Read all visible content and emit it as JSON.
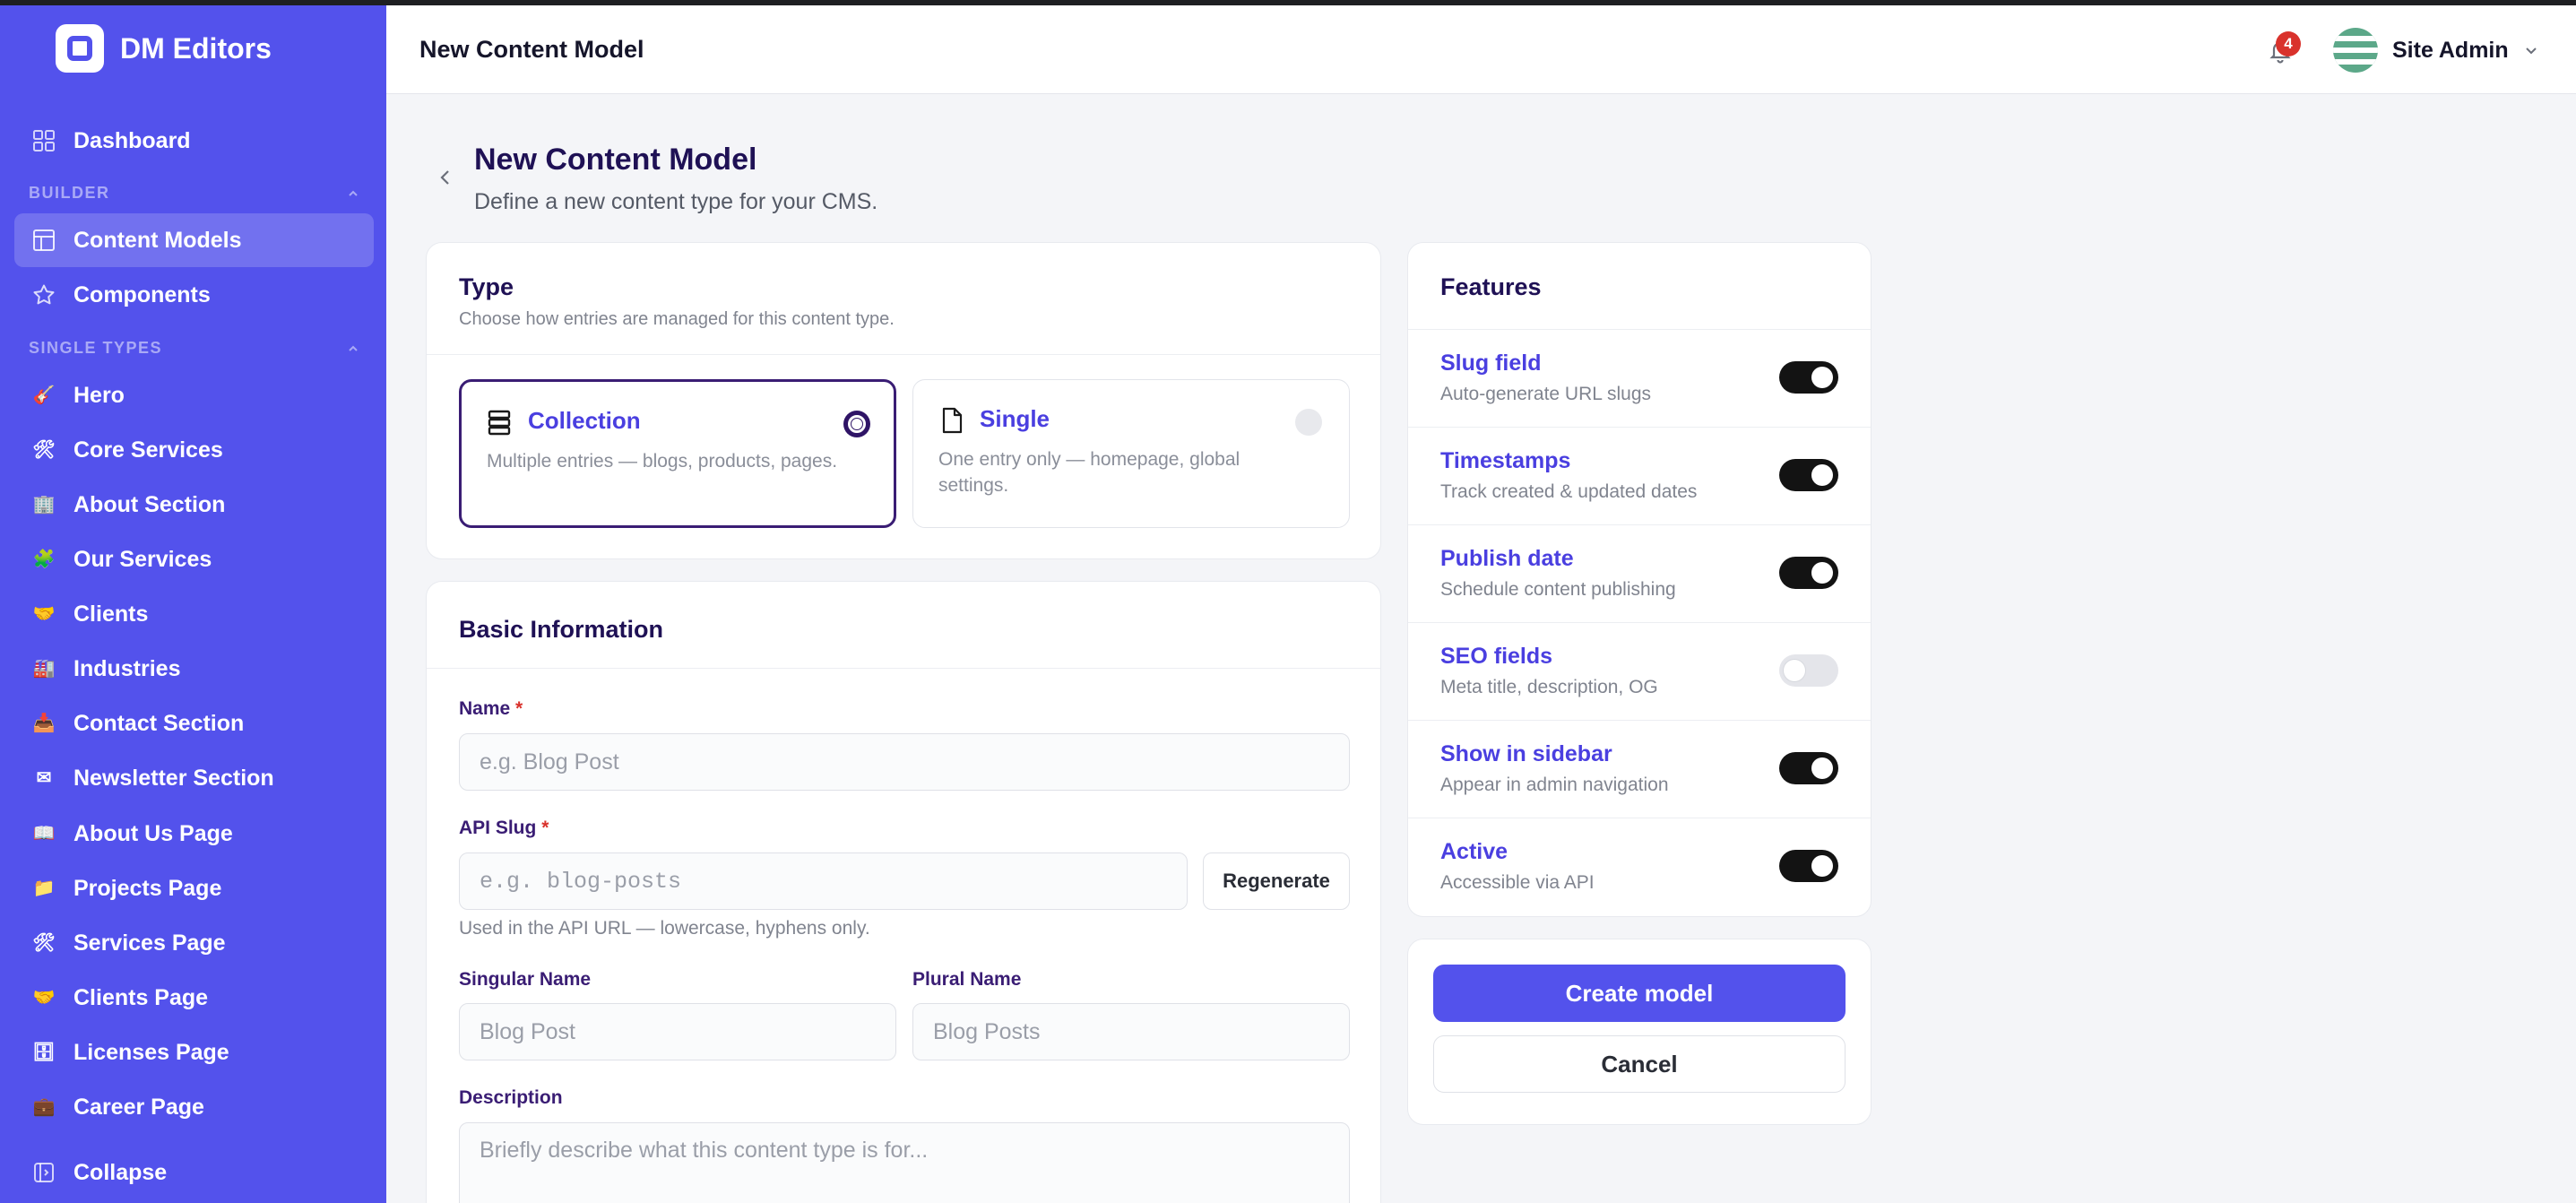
{
  "brand": {
    "name": "DM Editors"
  },
  "sidebar": {
    "dashboard": "Dashboard",
    "builder_label": "BUILDER",
    "builder_items": [
      {
        "label": "Content Models",
        "icon": "layout-icon"
      },
      {
        "label": "Components",
        "icon": "star-icon"
      }
    ],
    "single_types_label": "SINGLE TYPES",
    "single_items": [
      {
        "label": "Hero",
        "icon": "guitar-emoji"
      },
      {
        "label": "Core Services",
        "icon": "tools-emoji"
      },
      {
        "label": "About Section",
        "icon": "building-emoji"
      },
      {
        "label": "Our Services",
        "icon": "puzzle-emoji"
      },
      {
        "label": "Clients",
        "icon": "handshake-emoji"
      },
      {
        "label": "Industries",
        "icon": "factory-emoji"
      },
      {
        "label": "Contact Section",
        "icon": "inbox-emoji"
      },
      {
        "label": "Newsletter Section",
        "icon": "mail-emoji"
      },
      {
        "label": "About Us Page",
        "icon": "book-emoji"
      },
      {
        "label": "Projects Page",
        "icon": "folder-emoji"
      },
      {
        "label": "Services Page",
        "icon": "tools-emoji"
      },
      {
        "label": "Clients Page",
        "icon": "handshake-emoji"
      },
      {
        "label": "Licenses Page",
        "icon": "cabinet-emoji"
      },
      {
        "label": "Career Page",
        "icon": "briefcase-emoji"
      }
    ],
    "collapse": "Collapse"
  },
  "topbar": {
    "title": "New Content Model",
    "notification_count": "4",
    "user_name": "Site Admin"
  },
  "page": {
    "title": "New Content Model",
    "subtitle": "Define a new content type for your CMS."
  },
  "type_card": {
    "title": "Type",
    "subtitle": "Choose how entries are managed for this content type.",
    "options": [
      {
        "title": "Collection",
        "desc": "Multiple entries — blogs, products, pages.",
        "selected": true
      },
      {
        "title": "Single",
        "desc": "One entry only — homepage, global settings.",
        "selected": false
      }
    ]
  },
  "basic_info": {
    "title": "Basic Information",
    "name_label": "Name",
    "name_placeholder": "e.g. Blog Post",
    "slug_label": "API Slug",
    "slug_placeholder": "e.g. blog-posts",
    "regenerate": "Regenerate",
    "slug_help": "Used in the API URL — lowercase, hyphens only.",
    "singular_label": "Singular Name",
    "singular_placeholder": "Blog Post",
    "plural_label": "Plural Name",
    "plural_placeholder": "Blog Posts",
    "description_label": "Description",
    "description_placeholder": "Briefly describe what this content type is for...",
    "required_mark": "*"
  },
  "features": {
    "title": "Features",
    "items": [
      {
        "title": "Slug field",
        "desc": "Auto-generate URL slugs",
        "on": true
      },
      {
        "title": "Timestamps",
        "desc": "Track created & updated dates",
        "on": true
      },
      {
        "title": "Publish date",
        "desc": "Schedule content publishing",
        "on": true
      },
      {
        "title": "SEO fields",
        "desc": "Meta title, description, OG",
        "on": false
      },
      {
        "title": "Show in sidebar",
        "desc": "Appear in admin navigation",
        "on": true
      },
      {
        "title": "Active",
        "desc": "Accessible via API",
        "on": true
      }
    ]
  },
  "actions": {
    "create": "Create model",
    "cancel": "Cancel"
  },
  "colors": {
    "sidebar": "#5352ec",
    "primary": "#5352ec",
    "heading": "#1f1155",
    "danger": "#d9322c"
  }
}
